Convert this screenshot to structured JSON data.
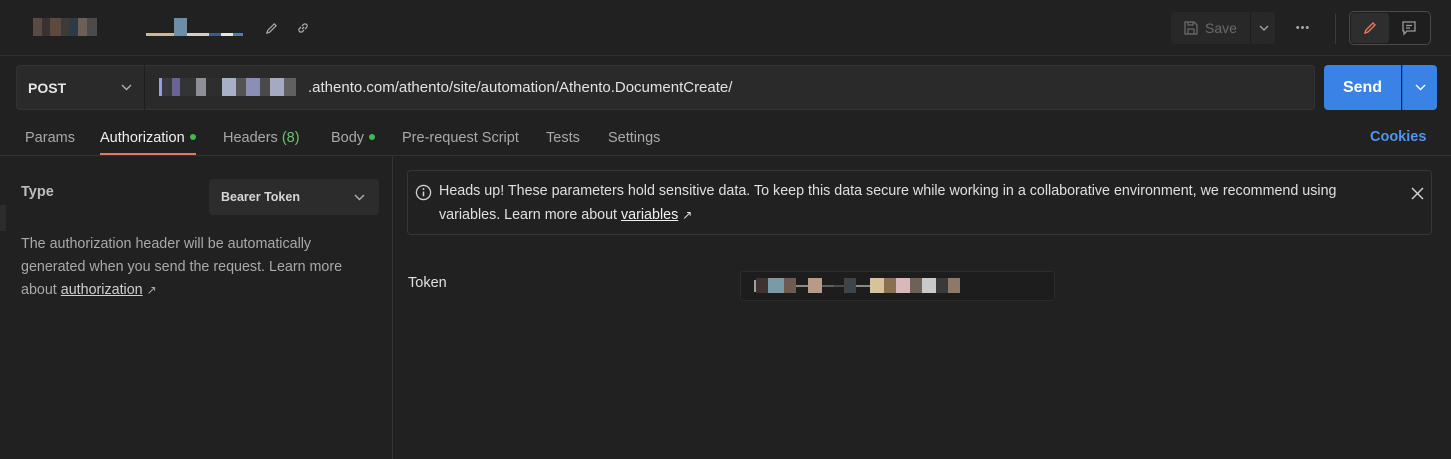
{
  "header": {
    "save_label": "Save",
    "more_label": "•••"
  },
  "request": {
    "method": "POST",
    "url_visible": ".athento.com/athento/site/automation/Athento.DocumentCreate/",
    "send_label": "Send"
  },
  "tabs": [
    {
      "label": "Params"
    },
    {
      "label": "Authorization"
    },
    {
      "label": "Headers",
      "count": "(8)"
    },
    {
      "label": "Body"
    },
    {
      "label": "Pre-request Script"
    },
    {
      "label": "Tests"
    },
    {
      "label": "Settings"
    }
  ],
  "cookies_label": "Cookies",
  "auth": {
    "type_label": "Type",
    "type_value": "Bearer Token",
    "desc_prefix": "The authorization header will be automatically generated when you send the request. Learn more about",
    "desc_link": "authorization",
    "arrow": "↗"
  },
  "alert": {
    "text": "Heads up! These parameters hold sensitive data. To keep this data secure while working in a collaborative environment, we recommend using variables. Learn more about",
    "link": "variables",
    "arrow": "↗"
  },
  "token": {
    "label": "Token"
  },
  "colors": {
    "accent_orange": "#e8765a",
    "send_blue": "#3b82e6",
    "cookies_blue": "#4f95f0",
    "status_green": "#3fb950"
  }
}
